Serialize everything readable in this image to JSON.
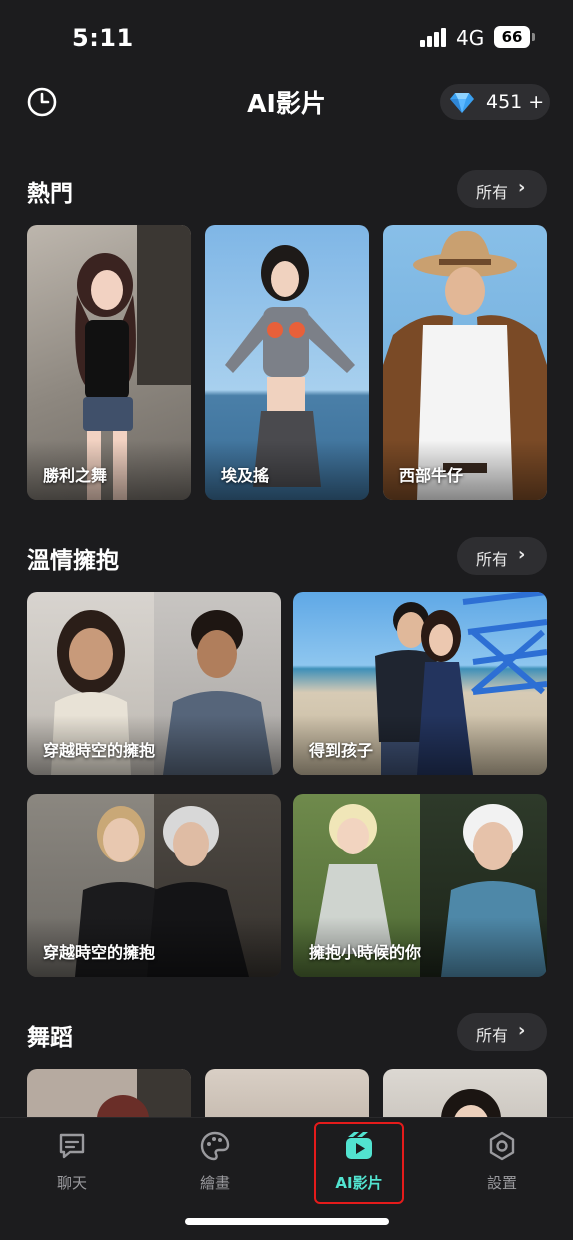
{
  "status_bar": {
    "time": "5:11",
    "network": "4G",
    "battery": "66"
  },
  "header": {
    "title": "AI影片",
    "gems": "451 +"
  },
  "sections": [
    {
      "title": "熱門",
      "all_label": "所有",
      "cards": [
        {
          "label": "勝利之舞"
        },
        {
          "label": "埃及搖"
        },
        {
          "label": "西部牛仔"
        }
      ]
    },
    {
      "title": "溫情擁抱",
      "all_label": "所有",
      "cards": [
        {
          "label": "穿越時空的擁抱"
        },
        {
          "label": "得到孩子"
        },
        {
          "label": "穿越時空的擁抱"
        },
        {
          "label": "擁抱小時候的你"
        }
      ]
    },
    {
      "title": "舞蹈",
      "all_label": "所有",
      "cards": []
    }
  ],
  "tabs": [
    {
      "label": "聊天",
      "icon": "chat-icon"
    },
    {
      "label": "繪畫",
      "icon": "palette-icon"
    },
    {
      "label": "AI影片",
      "icon": "video-icon",
      "active": true
    },
    {
      "label": "設置",
      "icon": "settings-icon"
    }
  ],
  "colors": {
    "accent": "#52e3d0",
    "highlight": "#e51b1b",
    "background": "#1c1c1e"
  }
}
